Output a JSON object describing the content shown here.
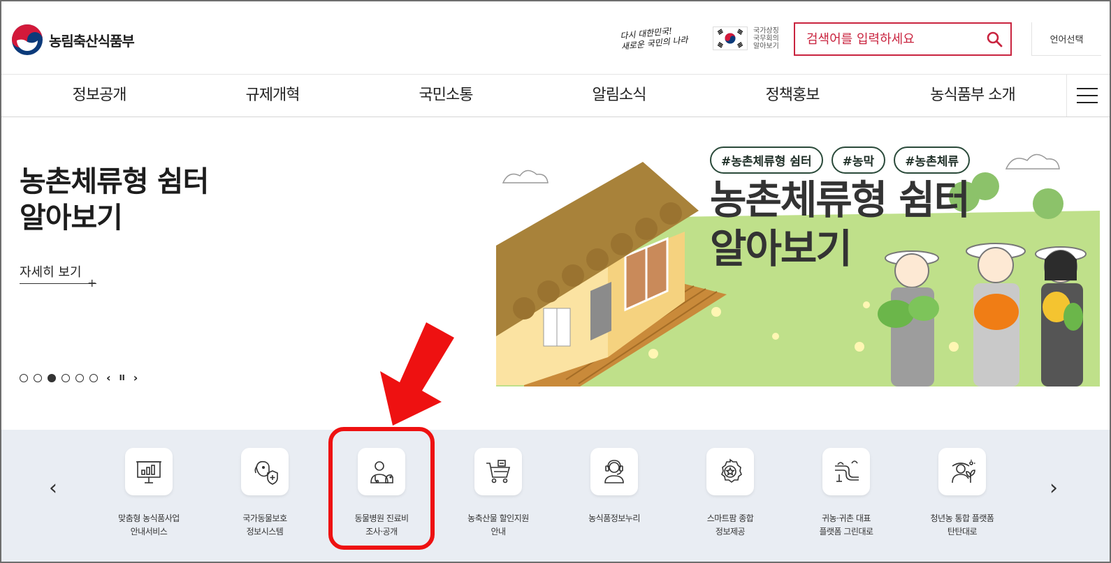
{
  "header": {
    "ministry_name": "농림축산식품부",
    "slogan_line1": "다시 대한민국!",
    "slogan_line2": "새로운 국민의 나라",
    "gov_link_line1": "국가상징",
    "gov_link_line2": "국무회의",
    "gov_link_line3": "알아보기",
    "search_placeholder": "검색어를 입력하세요",
    "language_label": "언어선택"
  },
  "nav": {
    "items": [
      "정보공개",
      "규제개혁",
      "국민소통",
      "알림소식",
      "정책홍보",
      "농식품부 소개"
    ]
  },
  "hero": {
    "title_line1": "농촌체류형 쉼터",
    "title_line2": "알아보기",
    "more_label": "자세히 보기",
    "more_plus": "+",
    "slide_count": 6,
    "active_slide": 3,
    "prev_label": "‹",
    "pause_label": "II",
    "next_label": "›"
  },
  "banner": {
    "tags": [
      "#농촌체류형 쉼터",
      "#농막",
      "#농촌체류"
    ],
    "title_line1": "농촌체류형 쉼터",
    "title_line2": "알아보기"
  },
  "quick_links": {
    "prev_label": "‹",
    "next_label": "›",
    "items": [
      {
        "line1": "맞춤형 농식품사업",
        "line2": "안내서비스",
        "icon": "presentation-chart-icon"
      },
      {
        "line1": "국가동물보호",
        "line2": "정보시스템",
        "icon": "dog-shield-icon"
      },
      {
        "line1": "동물병원 진료비",
        "line2": "조사·공개",
        "icon": "veterinarian-icon"
      },
      {
        "line1": "농축산물 할인지원",
        "line2": "안내",
        "icon": "shopping-cart-icon"
      },
      {
        "line1": "농식품정보누리",
        "line2": "",
        "icon": "headset-agent-icon"
      },
      {
        "line1": "스마트팜 종합",
        "line2": "정보제공",
        "icon": "award-badge-icon"
      },
      {
        "line1": "귀농·귀촌 대표",
        "line2": "플랫폼 그린대로",
        "icon": "green-road-icon"
      },
      {
        "line1": "청년농 통합 플랫폼",
        "line2": "탄탄대로",
        "icon": "young-farmer-icon"
      }
    ]
  },
  "colors": {
    "brand_red": "#c9243f",
    "quick_bg": "#e9edf3",
    "highlight": "#ee1111",
    "banner_grass": "#bfe08a",
    "roof_brown": "#a8823a"
  }
}
